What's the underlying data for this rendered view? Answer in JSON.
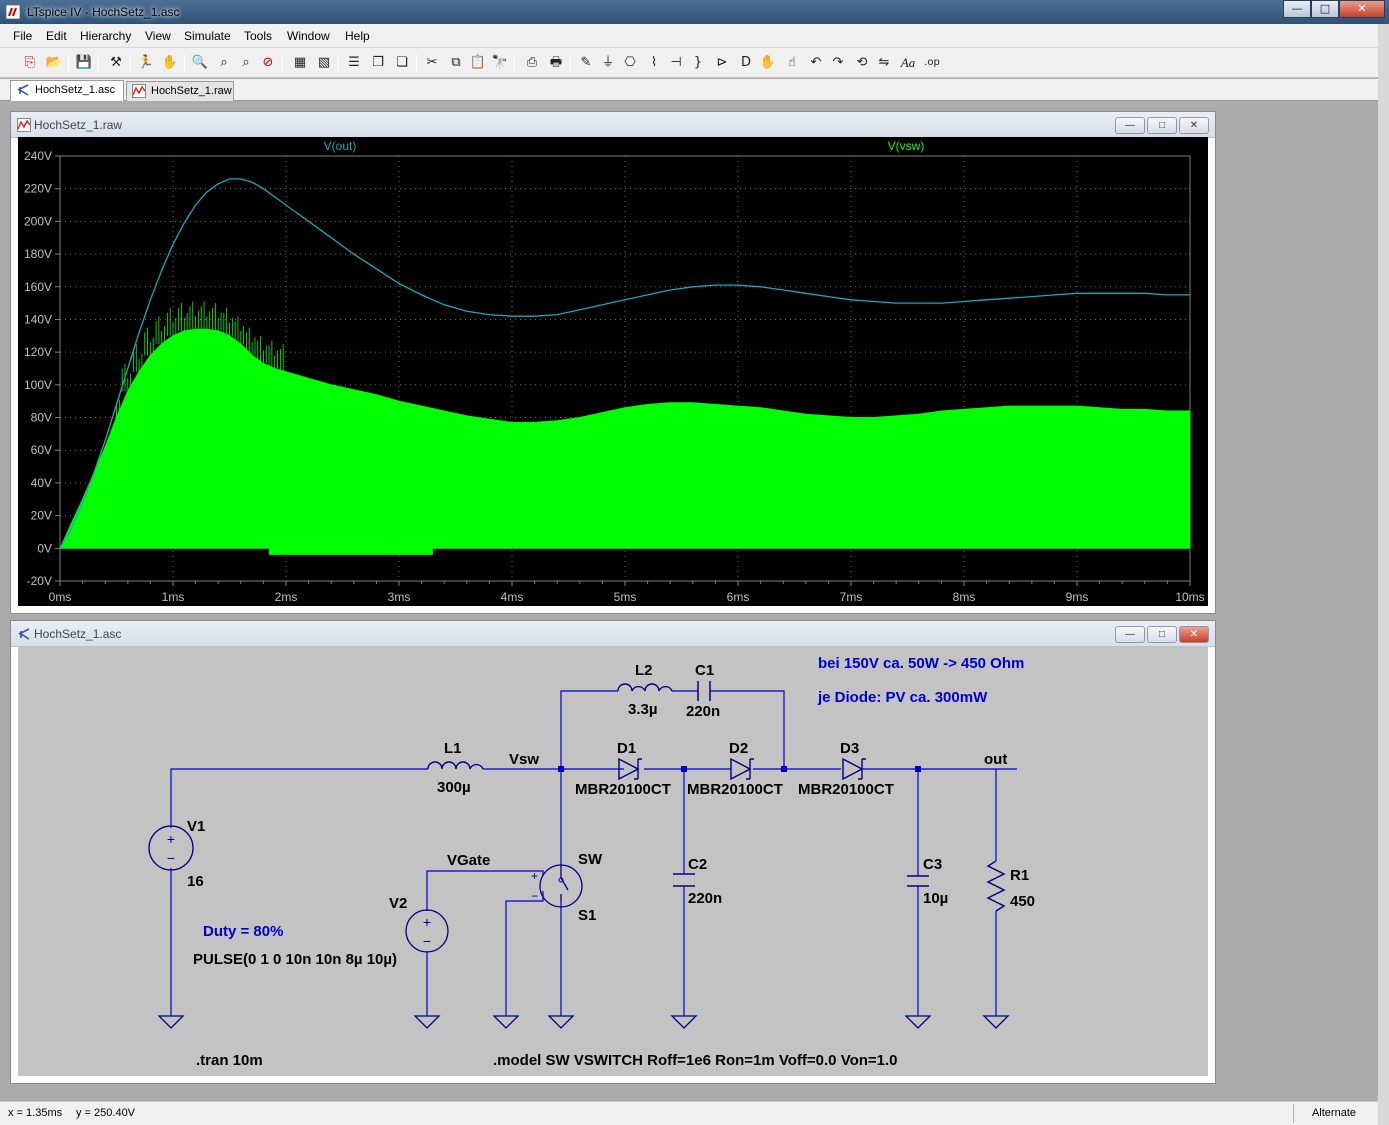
{
  "app": {
    "title": "LTspice IV - HochSetz_1.asc",
    "icon": "ltspice-logo-icon"
  },
  "window_buttons": {
    "minimize": "—",
    "maximize": "□",
    "close": "✕"
  },
  "menu": [
    {
      "label": "File",
      "key": "F"
    },
    {
      "label": "Edit",
      "key": "E"
    },
    {
      "label": "Hierarchy",
      "key": "i"
    },
    {
      "label": "View",
      "key": "V"
    },
    {
      "label": "Simulate",
      "key": "S"
    },
    {
      "label": "Tools",
      "key": "T"
    },
    {
      "label": "Window",
      "key": "W"
    },
    {
      "label": "Help",
      "key": "H"
    }
  ],
  "tabs": [
    {
      "label": "HochSetz_1.asc",
      "icon": "schematic-icon",
      "active": true
    },
    {
      "label": "HochSetz_1.raw",
      "icon": "waveform-icon",
      "active": false
    }
  ],
  "plot_window": {
    "title": "HochSetz_1.raw",
    "trace_labels": [
      {
        "name": "V(out)",
        "color": "#1fa7b8"
      },
      {
        "name": "V(vsw)",
        "color": "#00ff00"
      }
    ],
    "colors": {
      "background": "#000000",
      "grid": "#808080",
      "axis_text": "#c0c0c0"
    }
  },
  "chart_data": {
    "type": "line",
    "title": "",
    "xlabel": "",
    "ylabel": "",
    "xlim": [
      0,
      10
    ],
    "ylim": [
      -20,
      240
    ],
    "x_ticks": [
      "0ms",
      "1ms",
      "2ms",
      "3ms",
      "4ms",
      "5ms",
      "6ms",
      "7ms",
      "8ms",
      "9ms",
      "10ms"
    ],
    "y_ticks": [
      "-20V",
      "0V",
      "20V",
      "40V",
      "60V",
      "80V",
      "100V",
      "120V",
      "140V",
      "160V",
      "180V",
      "200V",
      "220V",
      "240V"
    ],
    "grid": "on",
    "series": [
      {
        "name": "V(out)",
        "color": "#1fa7b8",
        "x": [
          0,
          0.1,
          0.2,
          0.3,
          0.4,
          0.5,
          0.6,
          0.7,
          0.8,
          0.9,
          1.0,
          1.1,
          1.2,
          1.3,
          1.4,
          1.5,
          1.6,
          1.7,
          1.8,
          1.9,
          2.0,
          2.2,
          2.4,
          2.6,
          2.8,
          3.0,
          3.2,
          3.4,
          3.6,
          3.8,
          4.0,
          4.2,
          4.4,
          4.6,
          4.8,
          5.0,
          5.2,
          5.4,
          5.6,
          5.8,
          6.0,
          6.2,
          6.4,
          6.6,
          6.8,
          7.0,
          7.2,
          7.4,
          7.6,
          7.8,
          8.0,
          8.2,
          8.4,
          8.6,
          8.8,
          9.0,
          9.2,
          9.4,
          9.6,
          9.8,
          10.0
        ],
        "y": [
          0,
          12,
          28,
          46,
          66,
          88,
          110,
          132,
          152,
          170,
          186,
          199,
          210,
          218,
          223,
          226,
          226,
          224,
          220,
          215,
          210,
          200,
          190,
          180,
          171,
          162,
          155,
          149,
          145,
          143,
          142,
          142,
          143,
          146,
          149,
          152,
          155,
          158,
          160,
          161,
          161,
          160,
          158,
          156,
          154,
          152,
          151,
          150,
          150,
          150,
          151,
          152,
          153,
          154,
          155,
          156,
          156,
          156,
          156,
          155,
          155
        ]
      },
      {
        "name": "V(vsw)",
        "color": "#00ff00",
        "x": [
          0,
          0.1,
          0.2,
          0.3,
          0.4,
          0.5,
          0.6,
          0.7,
          0.8,
          0.9,
          1.0,
          1.1,
          1.2,
          1.3,
          1.4,
          1.5,
          1.6,
          1.7,
          1.8,
          1.9,
          2.0,
          2.2,
          2.4,
          2.6,
          2.8,
          3.0,
          3.2,
          3.4,
          3.6,
          3.8,
          4.0,
          4.2,
          4.4,
          4.6,
          4.8,
          5.0,
          5.2,
          5.4,
          5.6,
          5.8,
          6.0,
          6.2,
          6.4,
          6.6,
          6.8,
          7.0,
          7.2,
          7.4,
          7.6,
          7.8,
          8.0,
          8.2,
          8.4,
          8.6,
          8.8,
          9.0,
          9.2,
          9.4,
          9.6,
          9.8,
          10.0
        ],
        "y": [
          0,
          15,
          30,
          46,
          62,
          80,
          96,
          108,
          118,
          125,
          130,
          133,
          134,
          134,
          133,
          130,
          125,
          118,
          113,
          110,
          108,
          104,
          100,
          97,
          94,
          90,
          87,
          84,
          81,
          79,
          77,
          77,
          78,
          80,
          83,
          86,
          88,
          89,
          89,
          88,
          87,
          86,
          84,
          82,
          81,
          80,
          80,
          81,
          82,
          84,
          85,
          86,
          87,
          87,
          87,
          87,
          86,
          85,
          85,
          84,
          84
        ],
        "y_min": 0
      }
    ]
  },
  "schematic_window": {
    "title": "HochSetz_1.asc",
    "colors": {
      "background": "#c3c3c3",
      "wire": "#0000cc",
      "component": "#000080",
      "text": "#000000",
      "comment": "#0000cc"
    },
    "components": {
      "V1": {
        "name": "V1",
        "value": "16"
      },
      "V2": {
        "name": "V2",
        "value": "PULSE(0 1 0 10n 10n 8µ 10µ)"
      },
      "L1": {
        "name": "L1",
        "value": "300µ"
      },
      "L2": {
        "name": "L2",
        "value": "3.3µ"
      },
      "C1": {
        "name": "C1",
        "value": "220n"
      },
      "C2": {
        "name": "C2",
        "value": "220n"
      },
      "C3": {
        "name": "C3",
        "value": "10µ"
      },
      "D1": {
        "name": "D1",
        "value": "MBR20100CT"
      },
      "D2": {
        "name": "D2",
        "value": "MBR20100CT"
      },
      "D3": {
        "name": "D3",
        "value": "MBR20100CT"
      },
      "R1": {
        "name": "R1",
        "value": "450"
      },
      "S1": {
        "name": "S1",
        "model": "SW"
      }
    },
    "nets": {
      "vsw": "Vsw",
      "out": "out",
      "vgate": "VGate"
    },
    "comments": {
      "note1": "bei 150V ca. 50W -> 450 Ohm",
      "note2": "je Diode: PV ca. 300mW",
      "duty": "Duty = 80%"
    },
    "directives": {
      "tran": ".tran 10m",
      "model": ".model SW VSWITCH Roff=1e6 Ron=1m Voff=0.0 Von=1.0"
    }
  },
  "statusbar": {
    "x": "x = 1.35ms",
    "y": "y = 250.40V",
    "mode": "Alternate"
  }
}
